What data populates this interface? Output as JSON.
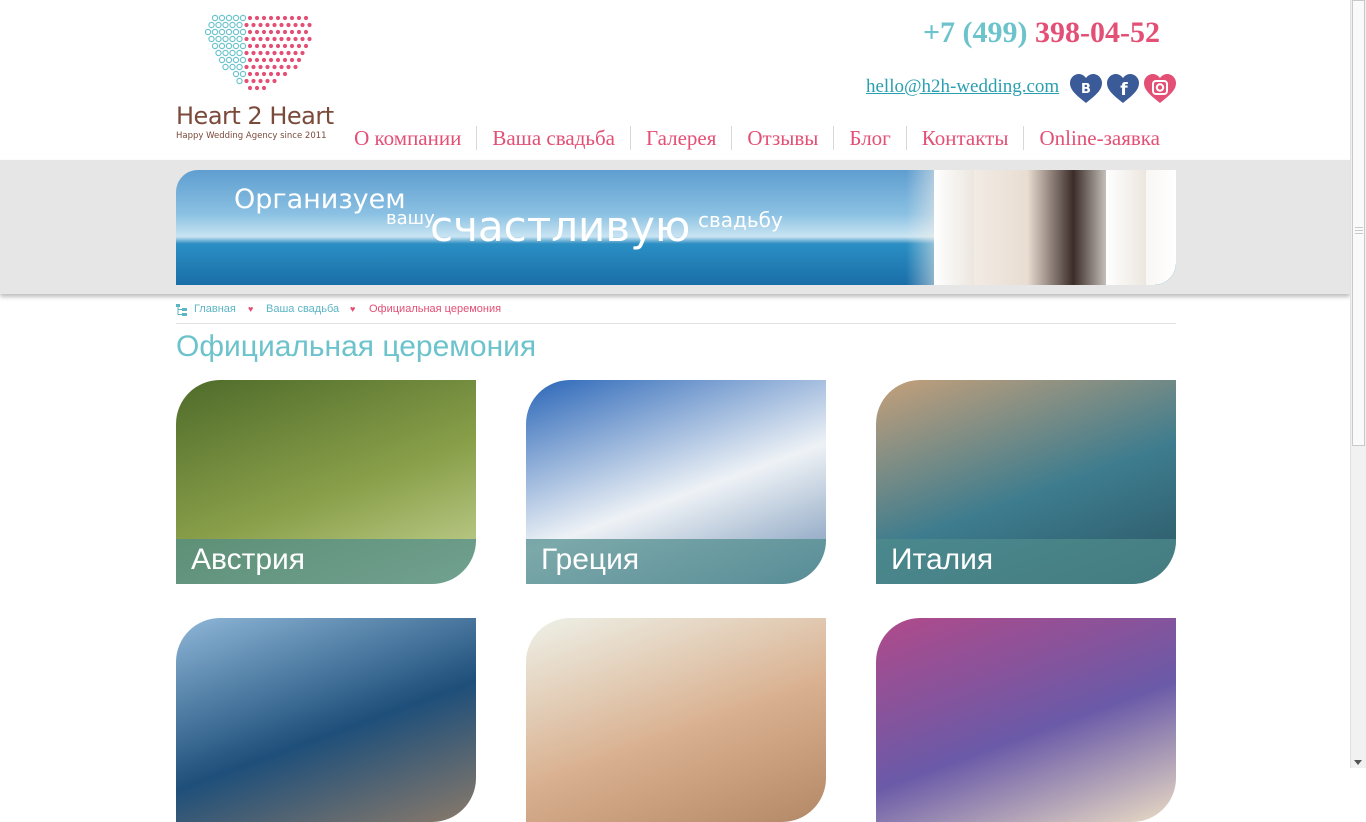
{
  "logo": {
    "title": "Heart 2 Heart",
    "subtitle": "Happy Wedding Agency since 2011"
  },
  "contact": {
    "phone_code": "+7 (499)",
    "phone_number": "398-04-52",
    "email": "hello@h2h-wedding.com"
  },
  "social": [
    {
      "icon": "vkontakte-icon",
      "color": "#3a5a98"
    },
    {
      "icon": "facebook-icon",
      "color": "#3a5a98"
    },
    {
      "icon": "instagram-icon",
      "color": "#e34f75"
    }
  ],
  "nav": [
    "О компании",
    "Ваша свадьба",
    "Галерея",
    "Отзывы",
    "Блог",
    "Контакты",
    "Online-заявка"
  ],
  "banner": {
    "line1": "Организуем",
    "line2": "вашу",
    "line3": "счастливую",
    "line4": "свадьбу"
  },
  "breadcrumb": {
    "home": "Главная",
    "section": "Ваша свадьба",
    "current": "Официальная церемония"
  },
  "page_title": "Официальная церемония",
  "cards": [
    {
      "label": "Австрия",
      "colors": [
        "#4e6b2a",
        "#8aa04a",
        "#c9d69a"
      ]
    },
    {
      "label": "Греция",
      "colors": [
        "#2a66b8",
        "#eef2f6",
        "#6f8fb3"
      ]
    },
    {
      "label": "Италия",
      "colors": [
        "#c6a07a",
        "#3d7c8e",
        "#2b5563"
      ]
    },
    {
      "label": "",
      "colors": [
        "#8fb7d8",
        "#1e4f7a",
        "#8a7a6a"
      ]
    },
    {
      "label": "",
      "colors": [
        "#eef1e8",
        "#d9b08f",
        "#b38867"
      ]
    },
    {
      "label": "",
      "colors": [
        "#b04a8a",
        "#6a5aa8",
        "#eadcc4"
      ]
    }
  ],
  "theme": {
    "accent": "#e34f75",
    "teal": "#6cc3cc",
    "brown": "#7a4a3a"
  }
}
